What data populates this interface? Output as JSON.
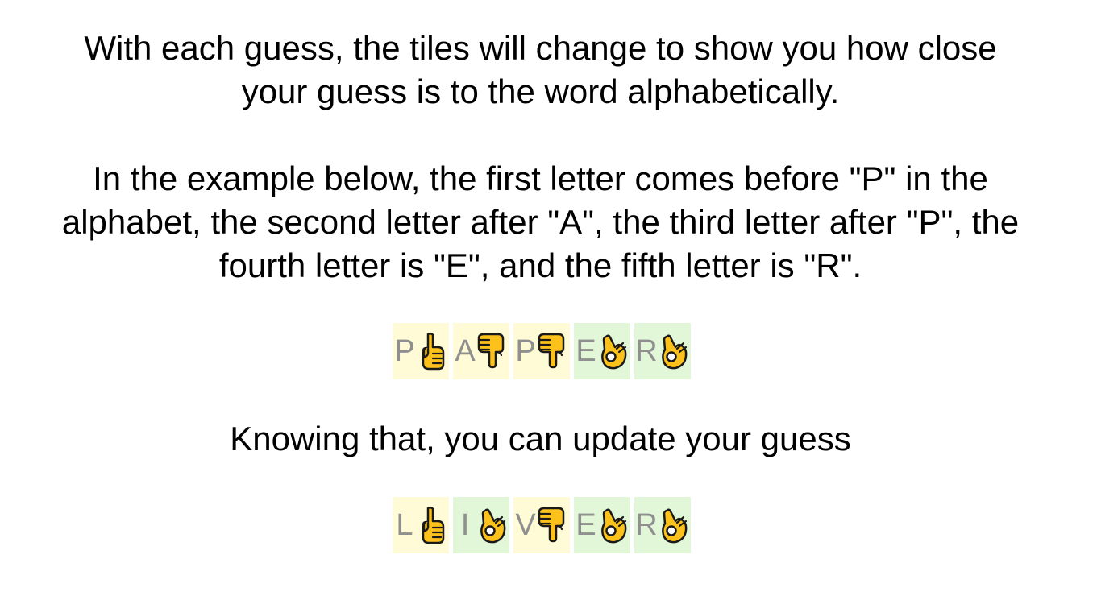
{
  "intro": {
    "lines": [
      "With each guess, the tiles will change to show you how close",
      "your guess is to the word alphabetically."
    ]
  },
  "example_text": {
    "lines": [
      "In the example below, the first letter comes before \"P\" in the",
      "alphabet, the second letter after \"A\", the third letter after \"P\", the",
      "fourth letter is \"E\", and the fifth letter is \"R\"."
    ]
  },
  "example_row": {
    "tiles": [
      {
        "letter": "P",
        "status": "before",
        "icon": "pointing-up-icon"
      },
      {
        "letter": "A",
        "status": "after",
        "icon": "pointing-down-icon"
      },
      {
        "letter": "P",
        "status": "after",
        "icon": "pointing-down-icon"
      },
      {
        "letter": "E",
        "status": "exact",
        "icon": "ok-hand-icon"
      },
      {
        "letter": "R",
        "status": "exact",
        "icon": "ok-hand-icon"
      }
    ]
  },
  "knowing": {
    "text": "Knowing that, you can update your guess"
  },
  "update_row": {
    "tiles": [
      {
        "letter": "L",
        "status": "before",
        "icon": "pointing-up-icon"
      },
      {
        "letter": "I",
        "status": "exact",
        "icon": "ok-hand-icon"
      },
      {
        "letter": "V",
        "status": "after",
        "icon": "pointing-down-icon"
      },
      {
        "letter": "E",
        "status": "exact",
        "icon": "ok-hand-icon"
      },
      {
        "letter": "R",
        "status": "exact",
        "icon": "ok-hand-icon"
      }
    ]
  },
  "colors": {
    "before_after_tile": "#fefbd6",
    "exact_tile": "#e2f7d8",
    "letter": "#8f8f8f",
    "hand_fill": "#fcc21b",
    "hand_outline": "#1a1a1a"
  }
}
